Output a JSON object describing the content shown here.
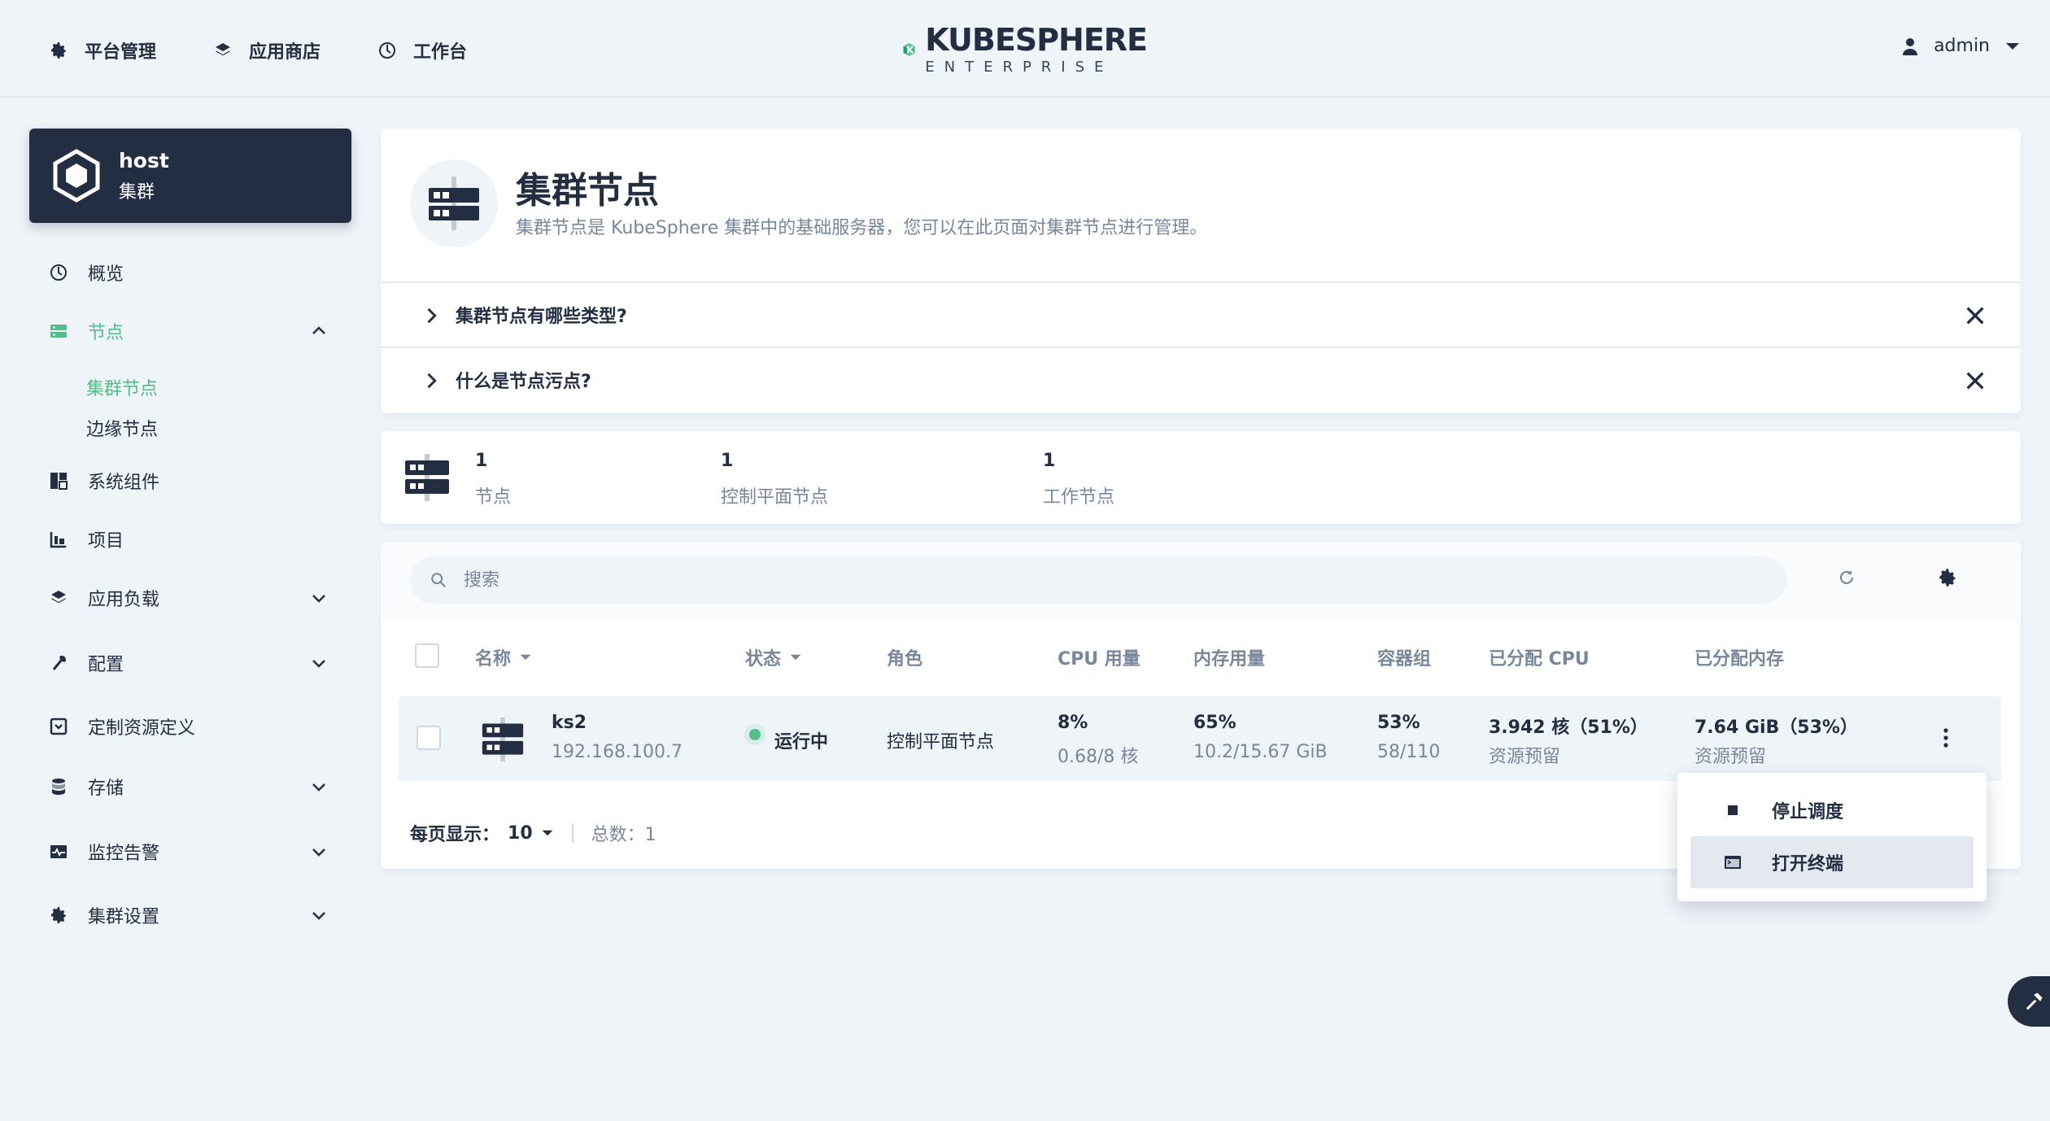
{
  "topnav": {
    "platform": "平台管理",
    "appstore": "应用商店",
    "workbench": "工作台"
  },
  "logo": {
    "main": "KUBESPHERE",
    "sub": "ENTERPRISE"
  },
  "user": {
    "name": "admin"
  },
  "cluster": {
    "name": "host",
    "type": "集群"
  },
  "sidebar": {
    "overview": "概览",
    "nodes": "节点",
    "cluster_nodes": "集群节点",
    "edge_nodes": "边缘节点",
    "components": "系统组件",
    "projects": "项目",
    "workloads": "应用负载",
    "config": "配置",
    "crd": "定制资源定义",
    "storage": "存储",
    "monitoring": "监控告警",
    "settings": "集群设置"
  },
  "page": {
    "title": "集群节点",
    "description": "集群节点是 KubeSphere 集群中的基础服务器，您可以在此页面对集群节点进行管理。"
  },
  "faq": [
    {
      "question": "集群节点有哪些类型?"
    },
    {
      "question": "什么是节点污点?"
    }
  ],
  "stats": [
    {
      "value": "1",
      "label": "节点"
    },
    {
      "value": "1",
      "label": "控制平面节点"
    },
    {
      "value": "1",
      "label": "工作节点"
    }
  ],
  "search": {
    "placeholder": "搜索"
  },
  "table": {
    "columns": {
      "name": "名称",
      "status": "状态",
      "role": "角色",
      "cpu": "CPU 用量",
      "memory": "内存用量",
      "pods": "容器组",
      "alloc_cpu": "已分配 CPU",
      "alloc_mem": "已分配内存"
    },
    "rows": [
      {
        "name": "ks2",
        "ip": "192.168.100.7",
        "status": "运行中",
        "role": "控制平面节点",
        "cpu_pct": "8%",
        "cpu_detail": "0.68/8 核",
        "mem_pct": "65%",
        "mem_detail": "10.2/15.67 GiB",
        "pods_pct": "53%",
        "pods_detail": "58/110",
        "alloc_cpu": "3.942 核（51%）",
        "alloc_cpu_sub": "资源预留",
        "alloc_mem": "7.64 GiB（53%）",
        "alloc_mem_sub": "资源预留"
      }
    ]
  },
  "pagination": {
    "per_page_label": "每页显示：",
    "per_page": "10",
    "total": "总数：1"
  },
  "dropdown": {
    "cordon": "停止调度",
    "terminal": "打开终端"
  },
  "colors": {
    "accent": "#55bc8a",
    "dark": "#242e42",
    "muted": "#79879c",
    "bg": "#eff4f9"
  }
}
